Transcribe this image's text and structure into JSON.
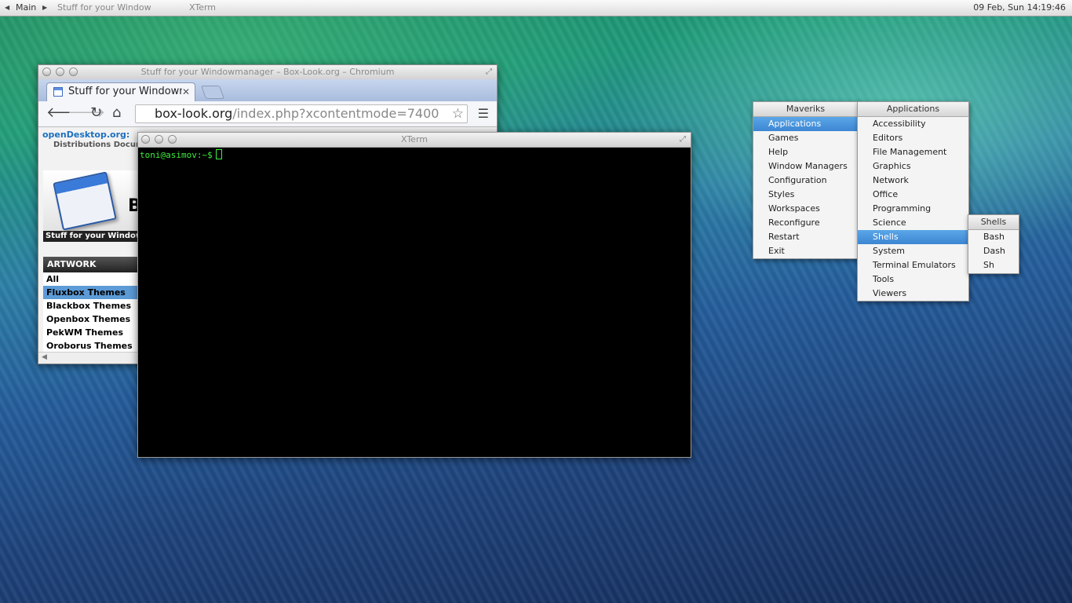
{
  "toolbar": {
    "workspace": "Main",
    "tasks": [
      "Stuff for your Window",
      "XTerm"
    ],
    "clock": "09 Feb, Sun 14:19:46"
  },
  "chromium": {
    "title": "Stuff for your Windowmanager – Box-Look.org – Chromium",
    "tab_label": "Stuff for your Windowm",
    "url_host": "box-look.org",
    "url_path": "/index.php?xcontentmode=7400",
    "page": {
      "od_logo": "openDesktop.org:",
      "od_nav": "Distributions   Docum",
      "big_letter": "B",
      "stuff_bar": "Stuff for your Window",
      "artwork_header": "ARTWORK",
      "artwork_items": [
        "All",
        "Fluxbox Themes",
        "Blackbox Themes",
        "Openbox Themes",
        "PekWM Themes",
        "Oroborus Themes"
      ],
      "selected_item": "Fluxbox Themes"
    }
  },
  "xterm": {
    "title": "XTerm",
    "prompt": "toni@asimov:~$"
  },
  "menus": {
    "main": {
      "title": "Maveriks",
      "items": [
        "Applications",
        "Games",
        "Help",
        "Window Managers",
        "Configuration",
        "Styles",
        "Workspaces",
        "Reconfigure",
        "Restart",
        "Exit"
      ],
      "selected": "Applications"
    },
    "applications": {
      "title": "Applications",
      "items": [
        "Accessibility",
        "Editors",
        "File Management",
        "Graphics",
        "Network",
        "Office",
        "Programming",
        "Science",
        "Shells",
        "System",
        "Terminal Emulators",
        "Tools",
        "Viewers"
      ],
      "selected": "Shells"
    },
    "shells": {
      "title": "Shells",
      "items": [
        "Bash",
        "Dash",
        "Sh"
      ]
    }
  },
  "colors": {
    "menu_highlight": "#4a97de",
    "terminal_text": "#3cf03c",
    "terminal_bg": "#000000"
  }
}
